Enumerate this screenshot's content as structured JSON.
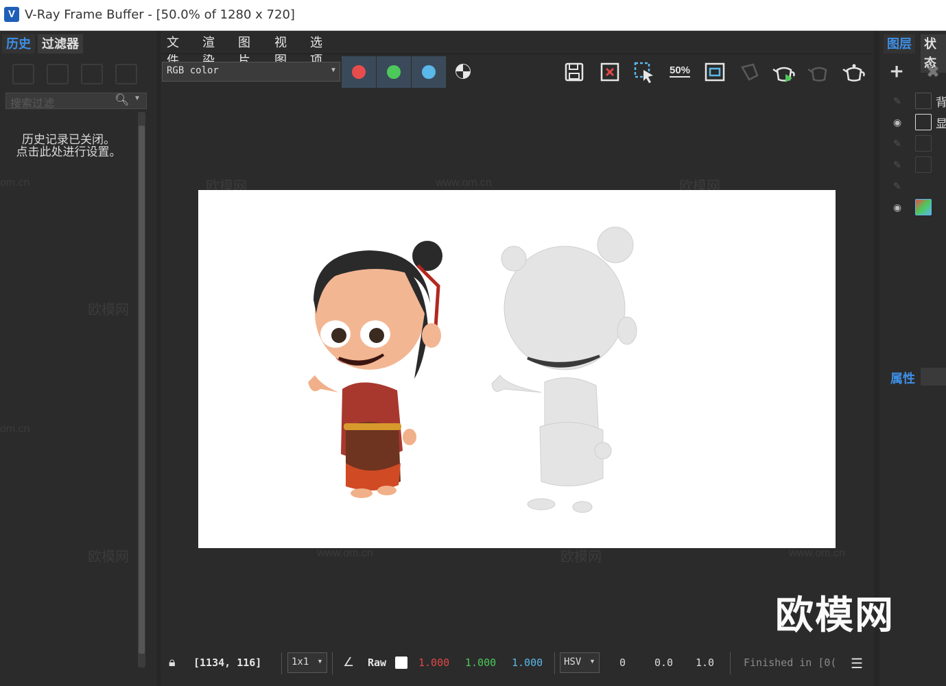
{
  "window": {
    "title": "V-Ray Frame Buffer - [50.0% of 1280 x 720]",
    "logo": "V"
  },
  "left_panel": {
    "tabs": [
      "历史",
      "过滤器"
    ],
    "search_placeholder": "搜索过滤",
    "message_line1": "历史记录已关闭。",
    "message_line2": "点击此处进行设置。"
  },
  "menu": [
    "文件",
    "渲染",
    "图片",
    "视图",
    "选项"
  ],
  "toolbar": {
    "channel": "RGB color",
    "zoom_label": "50%",
    "channel_colors": {
      "red": "#e84c4c",
      "green": "#4cc95a",
      "blue": "#5ab8ea"
    }
  },
  "status": {
    "coords": "[1134, 116]",
    "sample": "1x1",
    "mode": "Raw",
    "r": "1.000",
    "g": "1.000",
    "b": "1.000",
    "colorspace": "HSV",
    "h": "0",
    "s": "0.0",
    "v": "1.0",
    "finished": "Finished in [0("
  },
  "right_panel": {
    "tabs": [
      "图层",
      "状态"
    ],
    "layers": [
      "背",
      "显"
    ],
    "properties_label": "属性"
  },
  "watermarks": {
    "brand": "欧模网",
    "url": "www.om.cn",
    "url_short": "om.cn"
  }
}
